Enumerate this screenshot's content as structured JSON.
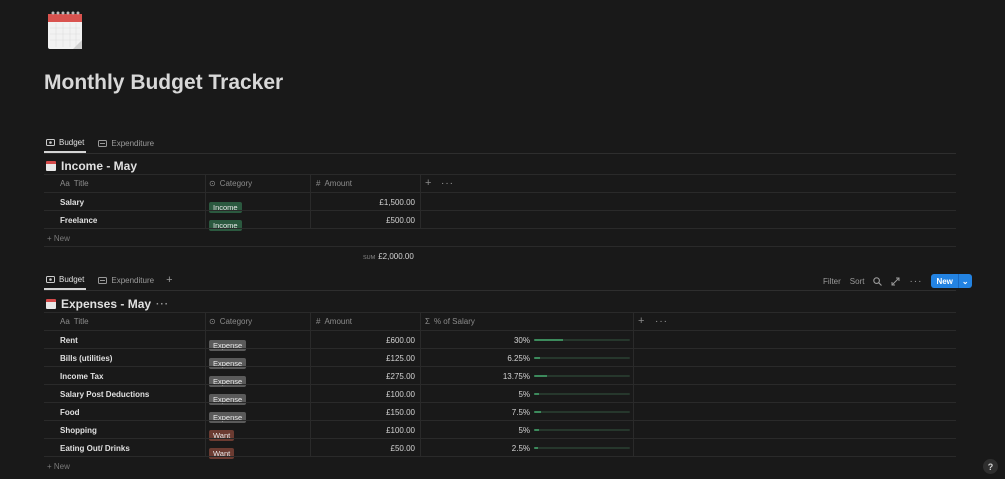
{
  "page": {
    "title": "Monthly Budget Tracker",
    "icon": "calendar-icon"
  },
  "tabs_top": [
    {
      "label": "Budget",
      "icon": "budget-icon"
    },
    {
      "label": "Expenditure",
      "icon": "expenditure-icon"
    }
  ],
  "income": {
    "heading": "Income - May",
    "columns": {
      "title": "Title",
      "category": "Category",
      "amount": "Amount"
    },
    "rows": [
      {
        "title": "Salary",
        "category": "Income",
        "amount": "£1,500.00"
      },
      {
        "title": "Freelance",
        "category": "Income",
        "amount": "£500.00"
      }
    ],
    "new_label": "New",
    "sum_label": "SUM",
    "sum_value": "£2,000.00"
  },
  "tabs_bottom": [
    {
      "label": "Budget",
      "icon": "budget-icon"
    },
    {
      "label": "Expenditure",
      "icon": "expenditure-icon"
    }
  ],
  "toolbar": {
    "filter": "Filter",
    "sort": "Sort",
    "new": "New"
  },
  "expenses": {
    "heading": "Expenses - May",
    "columns": {
      "title": "Title",
      "category": "Category",
      "amount": "Amount",
      "pct": "% of Salary"
    },
    "rows": [
      {
        "title": "Rent",
        "category": "Expense",
        "amount": "£600.00",
        "pct": "30%",
        "frac": 0.3
      },
      {
        "title": "Bills (utilities)",
        "category": "Expense",
        "amount": "£125.00",
        "pct": "6.25%",
        "frac": 0.0625
      },
      {
        "title": "Income Tax",
        "category": "Expense",
        "amount": "£275.00",
        "pct": "13.75%",
        "frac": 0.1375
      },
      {
        "title": "Salary Post Deductions",
        "category": "Expense",
        "amount": "£100.00",
        "pct": "5%",
        "frac": 0.05
      },
      {
        "title": "Food",
        "category": "Expense",
        "amount": "£150.00",
        "pct": "7.5%",
        "frac": 0.075
      },
      {
        "title": "Shopping",
        "category": "Want",
        "amount": "£100.00",
        "pct": "5%",
        "frac": 0.05
      },
      {
        "title": "Eating Out/ Drinks",
        "category": "Want",
        "amount": "£50.00",
        "pct": "2.5%",
        "frac": 0.025
      }
    ],
    "new_label": "New"
  },
  "help": "?"
}
